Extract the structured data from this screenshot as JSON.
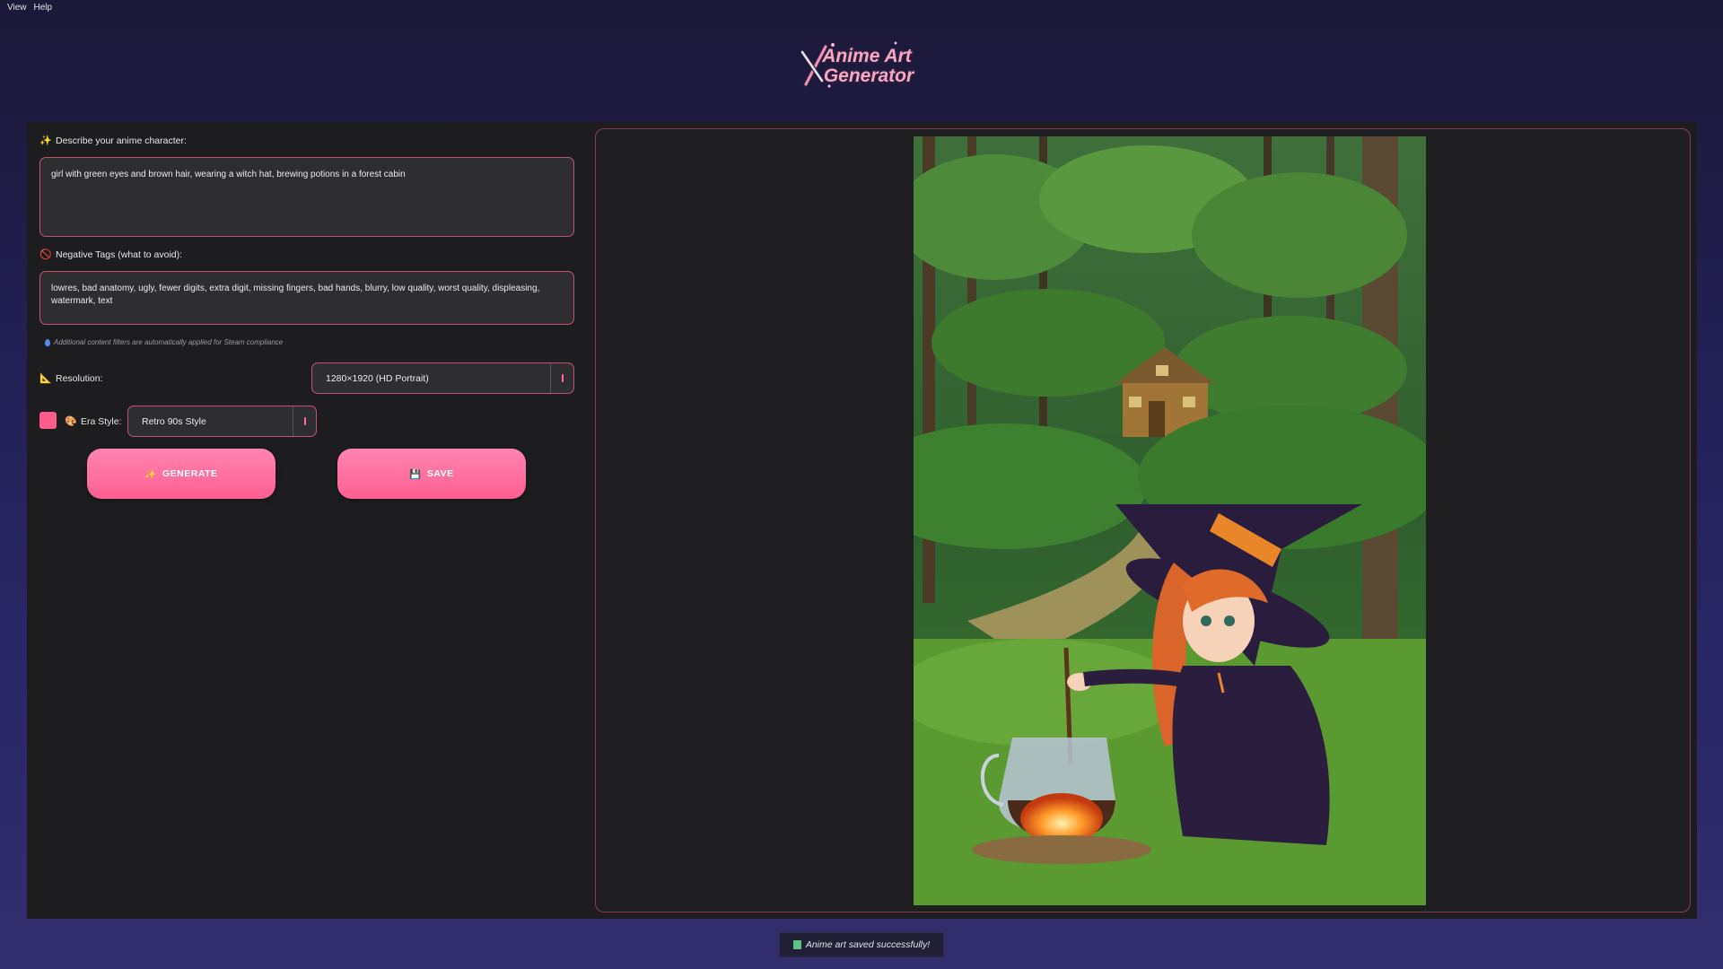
{
  "menu": {
    "items": [
      {
        "label": "View"
      },
      {
        "label": "Help"
      }
    ]
  },
  "logo": {
    "line1": "Anime Art",
    "line2": "Generator"
  },
  "form": {
    "describe": {
      "icon": "sparkles-icon",
      "icon_glyph": "✨",
      "label": "Describe your anime character:",
      "value": "girl with green eyes and brown hair, wearing a witch hat, brewing potions in a forest cabin"
    },
    "negative": {
      "icon": "no-entry-icon",
      "icon_glyph": "🚫",
      "label": "Negative Tags (what to avoid):",
      "value": "lowres, bad anatomy, ugly, fewer digits, extra digit, missing fingers, bad hands, blurry, low quality, worst quality, displeasing, watermark, text"
    },
    "note": "Additional content filters are automatically applied for Steam compliance",
    "resolution": {
      "icon": "ruler-icon",
      "icon_glyph": "📐",
      "label": "Resolution:",
      "value": "1280×1920 (HD Portrait)"
    },
    "era": {
      "icon": "palette-icon",
      "icon_glyph": "🎨",
      "label": "Era Style:",
      "value": "Retro 90s Style",
      "swatch_color": "#ff5c8e"
    }
  },
  "buttons": {
    "generate": {
      "icon": "sparkles-icon",
      "icon_glyph": "✨",
      "label": "GENERATE"
    },
    "save": {
      "icon": "floppy-disk-icon",
      "icon_glyph": "💾",
      "label": "SAVE"
    }
  },
  "toast": {
    "icon": "book-icon",
    "message": "Anime art saved successfully!"
  },
  "colors": {
    "accent": "#ff6b9a",
    "border": "#c4546e",
    "panel": "#1d1d1f"
  }
}
